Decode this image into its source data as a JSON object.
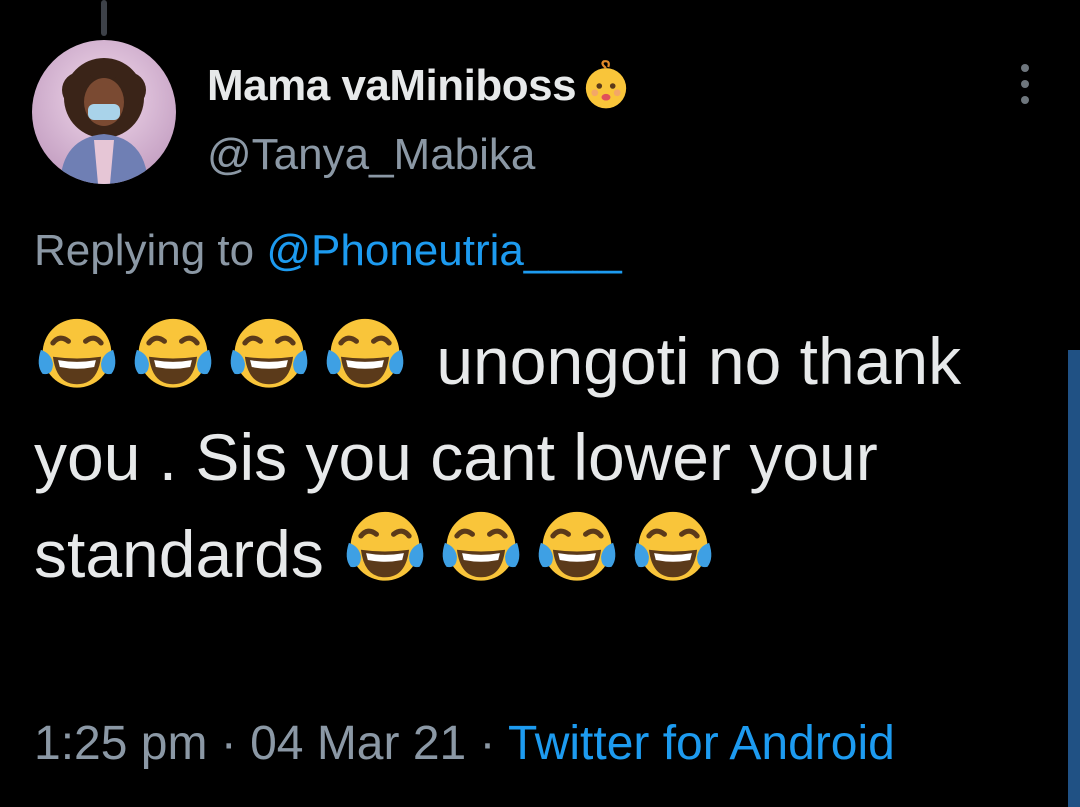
{
  "tweet": {
    "display_name": "Mama vaMiniboss",
    "name_emoji": "baby-face-emoji",
    "handle": "@Tanya_Mabika",
    "replying_prefix": "Replying to ",
    "replying_to": "@Phoneutria____",
    "body": {
      "lead_emojis": [
        "face-with-tears-of-joy",
        "face-with-tears-of-joy",
        "face-with-tears-of-joy",
        "face-with-tears-of-joy"
      ],
      "text_1": "unongoti no thank you . Sis you cant lower your standards",
      "trail_emojis": [
        "face-with-tears-of-joy",
        "face-with-tears-of-joy",
        "face-with-tears-of-joy",
        "face-with-tears-of-joy"
      ]
    },
    "time": "1:25 pm",
    "date": "04 Mar 21",
    "separator": " · ",
    "source": "Twitter for Android"
  },
  "colors": {
    "background": "#000000",
    "text": "#e7e9ea",
    "secondary": "#8b98a5",
    "accent": "#1d9bf0"
  }
}
